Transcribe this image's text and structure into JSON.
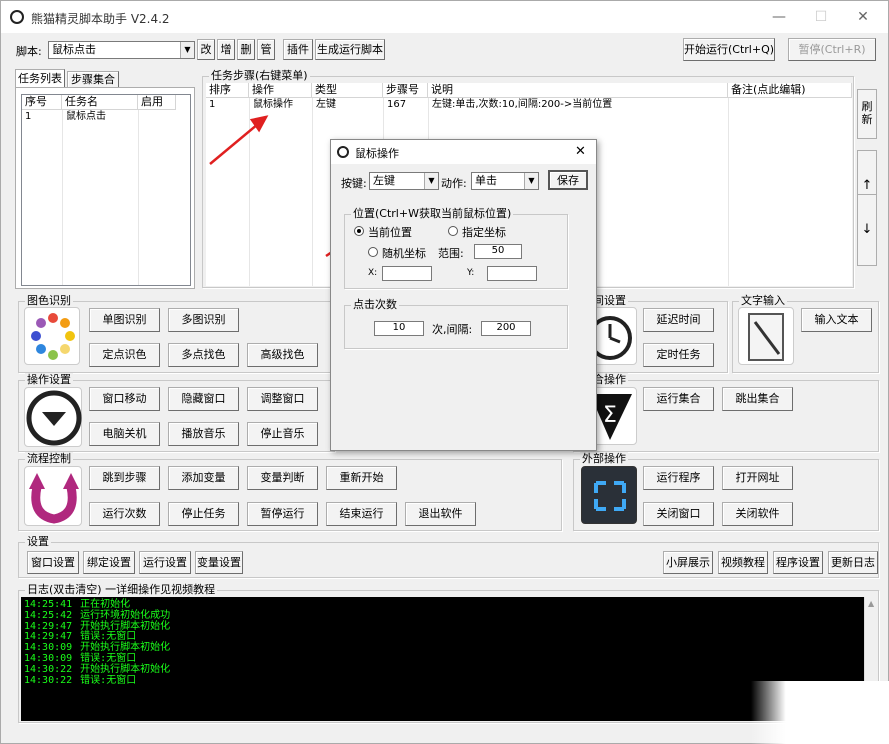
{
  "window": {
    "title": "熊猫精灵脚本助手  V2.4.2",
    "minimize": "—",
    "maximize": "☐",
    "close": "✕"
  },
  "toolbar": {
    "script_label": "脚本:",
    "script_value": "鼠标点击",
    "edit": "改",
    "add": "增",
    "delete": "删",
    "manage": "管",
    "plugin": "插件",
    "gen_script": "生成运行脚本",
    "start": "开始运行(Ctrl+Q)",
    "pause": "暂停(Ctrl+R)"
  },
  "task_list": {
    "tab1": "任务列表",
    "tab2": "步骤集合",
    "headers": [
      "序号",
      "任务名",
      "启用"
    ],
    "rows": [
      {
        "id": "1",
        "name": "鼠标点击",
        "enabled": ""
      }
    ]
  },
  "steps": {
    "group_title": "任务步骤(右键菜单)",
    "headers": [
      "排序",
      "操作",
      "类型",
      "步骤号",
      "说明",
      "备注(点此编辑)"
    ],
    "rows": [
      {
        "order": "1",
        "op": "鼠标操作",
        "type": "左键",
        "step": "167",
        "desc": "左键:单击,次数:10,间隔:200->当前位置",
        "note": ""
      }
    ]
  },
  "side_buttons": {
    "refresh": "刷新",
    "up": "↑",
    "down": "↓"
  },
  "image_recog": {
    "title": "图色识别",
    "single": "单图识别",
    "multi": "多图识别",
    "point_color": "定点识色",
    "multi_point": "多点找色",
    "advanced": "高级找色"
  },
  "op_settings": {
    "title": "操作设置",
    "move_window": "窗口移动",
    "hide_window": "隐藏窗口",
    "resize_window": "调整窗口",
    "shutdown": "电脑关机",
    "play_music": "播放音乐",
    "stop_music": "停止音乐"
  },
  "flow": {
    "title": "流程控制",
    "jump": "跳到步骤",
    "add_var": "添加变量",
    "var_judge": "变量判断",
    "restart": "重新开始",
    "run_count": "运行次数",
    "stop_task": "停止任务",
    "pause_run": "暂停运行",
    "end_run": "结束运行",
    "exit_app": "退出软件"
  },
  "time_settings": {
    "title": "时间设置",
    "delay": "延迟时间",
    "timed_task": "定时任务"
  },
  "text_input": {
    "title": "文字输入",
    "input_text": "输入文本"
  },
  "set_ops": {
    "title": "集合操作",
    "run_set": "运行集合",
    "jump_set": "跳出集合"
  },
  "external": {
    "title": "外部操作",
    "run_program": "运行程序",
    "open_url": "打开网址",
    "close_window": "关闭窗口",
    "close_app": "关闭软件"
  },
  "settings": {
    "title": "设置",
    "window_settings": "窗口设置",
    "bind_settings": "绑定设置",
    "run_settings": "运行设置",
    "var_settings": "变量设置",
    "small_screen": "小屏展示",
    "video_tutorial": "视频教程",
    "program_settings": "程序设置",
    "update_log": "更新日志"
  },
  "log": {
    "title": "日志(双击清空) 一详细操作见视频教程",
    "lines": [
      {
        "time": "14:25:41",
        "msg": "正在初始化"
      },
      {
        "time": "14:25:42",
        "msg": "运行环境初始化成功"
      },
      {
        "time": "14:29:47",
        "msg": "开始执行脚本初始化"
      },
      {
        "time": "14:29:47",
        "msg": "错误:无窗口"
      },
      {
        "time": "14:30:09",
        "msg": "开始执行脚本初始化"
      },
      {
        "time": "14:30:09",
        "msg": "错误:无窗口"
      },
      {
        "time": "14:30:22",
        "msg": "开始执行脚本初始化"
      },
      {
        "time": "14:30:22",
        "msg": "错误:无窗口"
      }
    ]
  },
  "dialog": {
    "title": "鼠标操作",
    "close": "✕",
    "key_label": "按键:",
    "key_value": "左键",
    "action_label": "动作:",
    "action_value": "单击",
    "save": "保存",
    "pos_group": "位置(Ctrl+W获取当前鼠标位置)",
    "current_pos": "当前位置",
    "specified": "指定坐标",
    "random": "随机坐标",
    "range_label": "范围:",
    "range_value": "50",
    "x_label": "X:",
    "y_label": "Y:",
    "x_value": "",
    "y_value": "",
    "click_group": "点击次数",
    "count": "10",
    "interval_label": "次,间隔:",
    "interval": "200"
  },
  "colors": {
    "log_text": "#1aff1a",
    "arrow": "#e02020"
  }
}
